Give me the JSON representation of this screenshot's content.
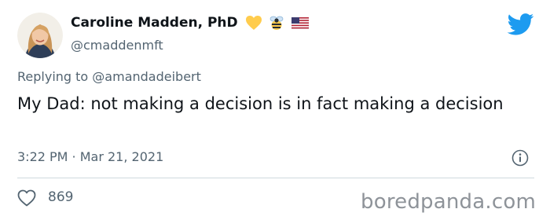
{
  "author": {
    "name": "Caroline Madden, PhD",
    "handle": "@cmaddenmft",
    "emojis": [
      "yellow-heart-emoji",
      "bee-emoji",
      "us-flag-emoji"
    ]
  },
  "reply": {
    "prefix": "Replying to",
    "to": "@amandadeibert"
  },
  "tweet": {
    "text": "My Dad: not making a decision is in fact making a decision",
    "timestamp": "3:22 PM · Mar 21, 2021"
  },
  "stats": {
    "likes": "869"
  },
  "watermark": "boredpanda.com",
  "colors": {
    "twitter_blue": "#1d9bf0",
    "secondary_text": "#536471",
    "primary_text": "#0f1419"
  }
}
